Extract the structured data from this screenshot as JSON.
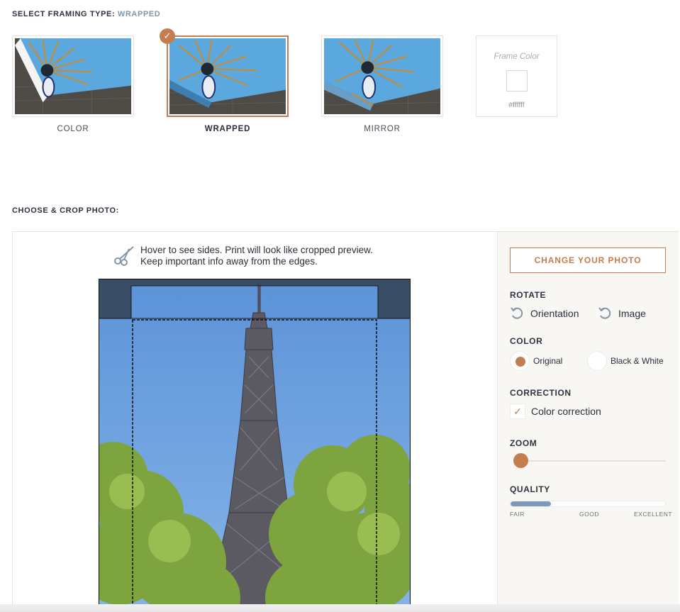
{
  "framing": {
    "heading_prefix": "SELECT FRAMING TYPE:",
    "heading_value": "WRAPPED",
    "options": [
      {
        "label": "COLOR",
        "selected": false
      },
      {
        "label": "WRAPPED",
        "selected": true
      },
      {
        "label": "MIRROR",
        "selected": false
      }
    ],
    "frame_color": {
      "title": "Frame Color",
      "hex": "#ffffff"
    }
  },
  "crop": {
    "heading": "CHOOSE & CROP PHOTO:",
    "hint_line1": "Hover to see sides. Print will look like cropped preview.",
    "hint_line2": "Keep important info away from the edges."
  },
  "controls": {
    "change_photo": "CHANGE YOUR PHOTO",
    "rotate_label": "ROTATE",
    "rotate_orientation": "Orientation",
    "rotate_image": "Image",
    "color_label": "COLOR",
    "color_original": "Original",
    "color_bw": "Black & White",
    "color_selected": "Original",
    "correction_label": "CORRECTION",
    "color_correction": "Color correction",
    "color_correction_checked": true,
    "zoom_label": "ZOOM",
    "zoom_level": 0,
    "quality_label": "QUALITY",
    "quality_level": 0.26,
    "quality_ticks": [
      "FAIR",
      "GOOD",
      "EXCELLENT"
    ]
  },
  "colors": {
    "accent": "#c47d4f",
    "quality_fill": "#7d9bb5",
    "heading_accent": "#7f97ab"
  },
  "icons": [
    "check-icon",
    "scissors-icon",
    "rotate-ccw-icon",
    "checkmark-icon"
  ]
}
